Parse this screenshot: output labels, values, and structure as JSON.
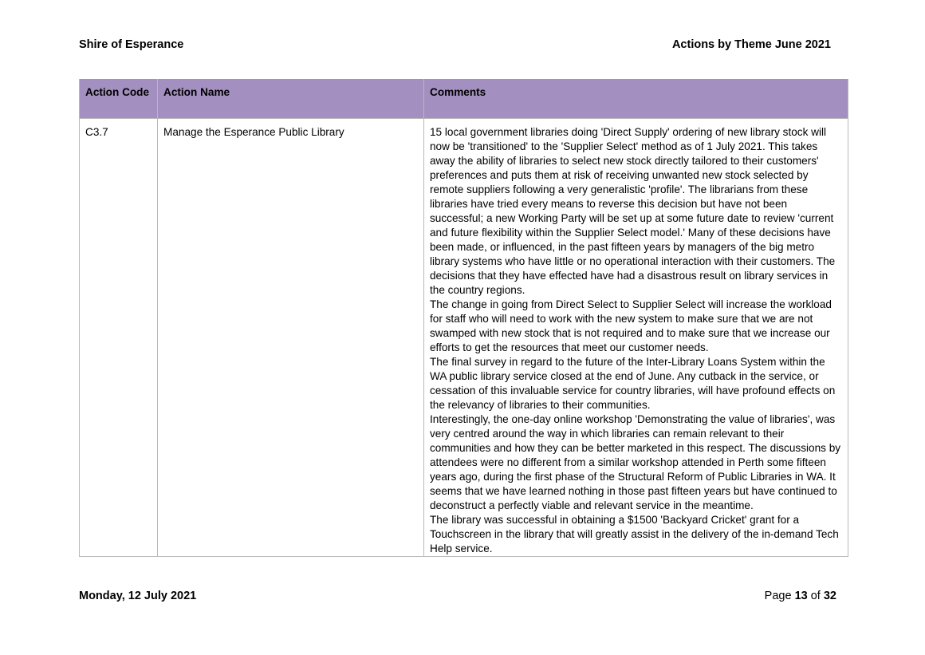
{
  "header": {
    "organisation": "Shire of Esperance",
    "report_title": "Actions by Theme June 2021"
  },
  "table": {
    "columns": [
      "Action Code",
      "Action Name",
      "Comments"
    ],
    "rows": [
      {
        "code": "C3.7",
        "name": "Manage the Esperance Public Library",
        "comments": [
          "15 local government libraries doing 'Direct Supply' ordering of new library stock will now be 'transitioned' to the 'Supplier Select' method as of 1 July 2021. This takes away the ability of libraries to select new stock directly tailored to their customers' preferences and puts them at risk of receiving unwanted new stock selected by remote suppliers following a very generalistic 'profile'. The librarians from these libraries have tried every means to reverse this decision but have not been successful; a new Working Party will be set up at some future date to review 'current and future flexibility within the Supplier Select model.' Many of these decisions have been made, or influenced, in the past fifteen years by managers of the big metro library systems who have little or no operational interaction with their customers. The decisions that they have effected have had a disastrous result on library services in the country regions.",
          "The change in going from Direct Select to Supplier Select will increase the workload for staff who will need to work with the new system to make sure that we are not swamped with new stock that is not required and to make sure that we increase our efforts to get the resources that meet our customer needs.",
          "The final survey in regard to the future of the Inter-Library Loans System within the WA public library service closed at the end of June. Any cutback in the service, or cessation of this invaluable service for country libraries, will have profound effects on the relevancy of libraries to their communities.",
          "Interestingly, the one-day online workshop 'Demonstrating the value of libraries', was very centred around the way in which libraries can remain relevant to their communities and how they can be better marketed in this respect. The discussions by attendees were no different from a similar workshop attended in Perth some fifteen years ago, during the first phase of the Structural Reform of Public Libraries in WA. It seems that we have learned nothing in those past fifteen years but have continued to deconstruct a perfectly viable and relevant service in the meantime.",
          "The library was successful in obtaining a $1500 'Backyard Cricket' grant for a Touchscreen in the library that will greatly assist in the delivery of the in-demand Tech Help service."
        ]
      }
    ]
  },
  "footer": {
    "date": "Monday, 12 July 2021",
    "page_prefix": "Page",
    "page_current": "13",
    "page_of": "of",
    "page_total": "32"
  }
}
